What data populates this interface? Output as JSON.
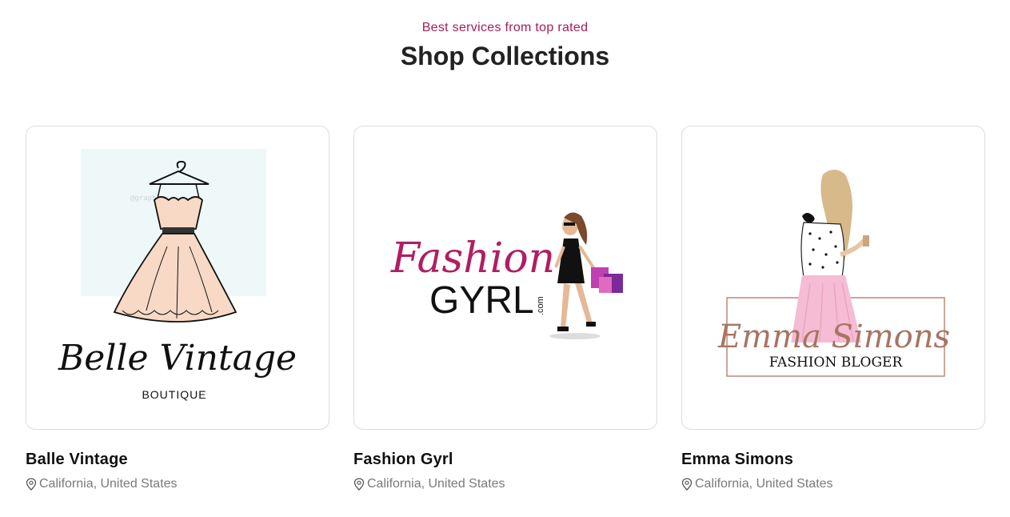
{
  "section": {
    "eyebrow": "Best services from top rated",
    "title": "Shop Collections"
  },
  "colors": {
    "accent": "#a51d5a",
    "title": "#222222",
    "muted": "#7a7a7a",
    "border": "#dcdcdc"
  },
  "shops": [
    {
      "name": "Balle Vintage",
      "location": "California, United States",
      "logo": {
        "script": "Belle Vintage",
        "tagline": "BOUTIQUE",
        "icon": "dress-on-hanger-icon",
        "watermark": "@graphics"
      }
    },
    {
      "name": "Fashion Gyrl",
      "location": "California, United States",
      "logo": {
        "script": "Fashion",
        "wordmark": "GYRL",
        "suffix": ".com",
        "icon": "shopping-woman-icon"
      }
    },
    {
      "name": "Emma Simons",
      "location": "California, United States",
      "logo": {
        "script": "Emma Simons",
        "tagline": "FASHION BLOGER",
        "icon": "blogger-woman-icon"
      }
    }
  ]
}
